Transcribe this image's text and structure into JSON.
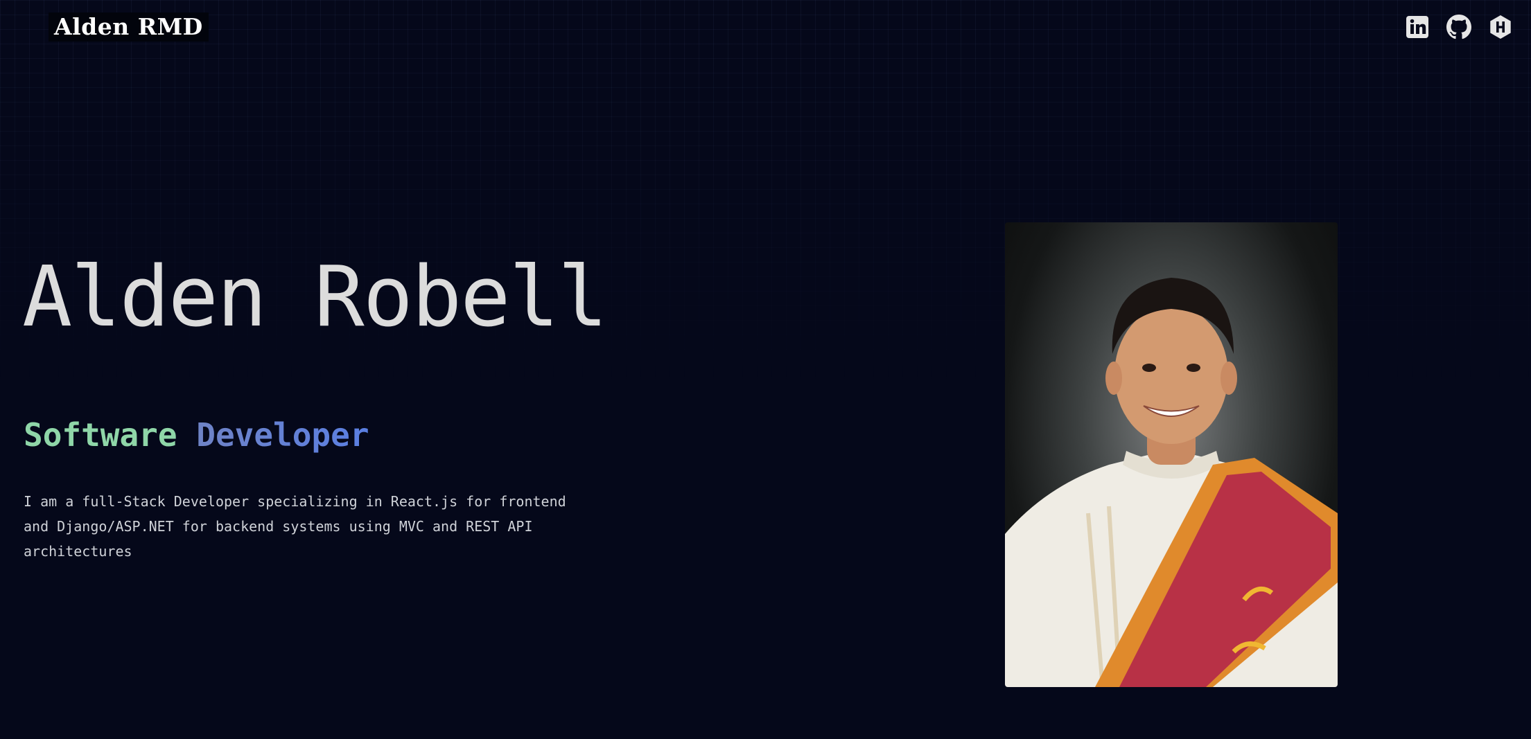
{
  "header": {
    "logo_text": "Alden RMD",
    "social": [
      {
        "icon": "linkedin-icon",
        "label": "LinkedIn"
      },
      {
        "icon": "github-icon",
        "label": "GitHub"
      },
      {
        "icon": "hashnode-icon",
        "label": "Hashnode"
      }
    ]
  },
  "hero": {
    "name": "Alden Robell",
    "role_word_1": "Software",
    "role_word_2": "Developer",
    "bio": "I am a full-Stack Developer specializing in React.js for frontend and Django/ASP.NET for backend systems using MVC and REST API architectures"
  },
  "colors": {
    "background": "#05081a",
    "role_word_1": "#8fd6a8",
    "role_word_2": "#5a7fe3",
    "text": "#dcdcdc"
  }
}
